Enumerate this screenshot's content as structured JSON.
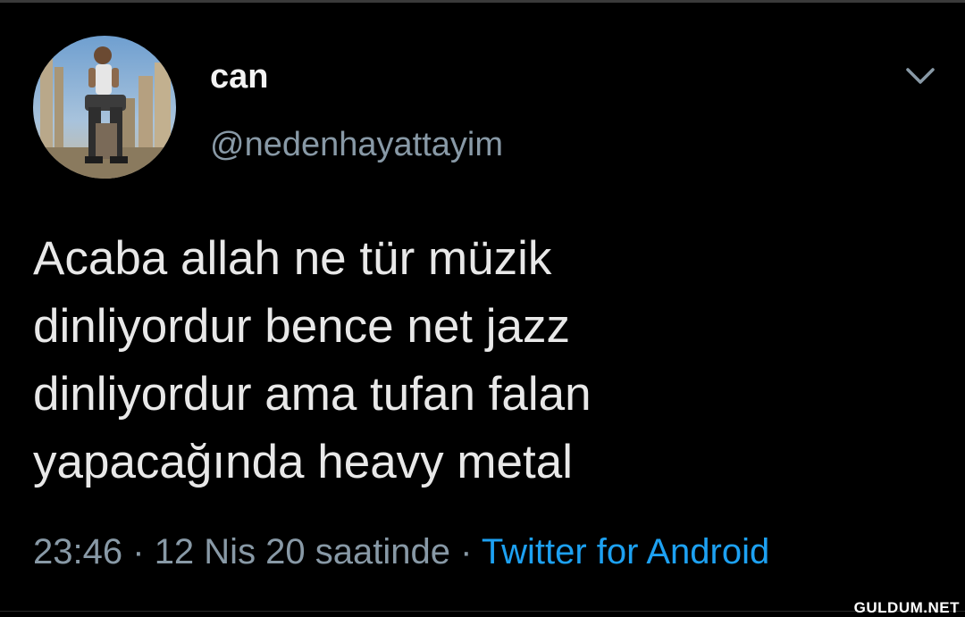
{
  "tweet": {
    "display_name": "can",
    "handle": "@nedenhayattayim",
    "text_lines": [
      "Acaba allah ne tür müzik",
      "dinliyordur bence net jazz",
      "dinliyordur ama tufan falan",
      "yapacağında heavy metal"
    ],
    "time": "23:46",
    "separator": "·",
    "date": "12 Nis 20 saatinde",
    "source": "Twitter for Android",
    "menu_icon": "chevron-down-icon",
    "avatar_icon": "avatar"
  },
  "watermark": "GULDUM.NET",
  "colors": {
    "background": "#000000",
    "secondary_text": "#8899a6",
    "link": "#1da1f2"
  }
}
